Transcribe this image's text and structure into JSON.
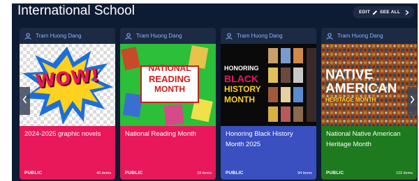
{
  "header": {
    "title": "International School",
    "edit_label": "EDIT",
    "see_all_label": "SEE ALL"
  },
  "icons": {
    "user": "user-icon",
    "edit": "pencil-icon",
    "see_all": "chevron-right-icon",
    "prev": "chevron-left-icon",
    "next": "chevron-right-icon"
  },
  "colors": {
    "panel": "#0d1b33",
    "card_header": "#1c2a44",
    "owner_text": "#8ab4ff",
    "pink": "#e8185a",
    "blue": "#3a4fc0",
    "green": "#1e7a1e"
  },
  "cards": [
    {
      "owner": "Tram Huong Dang",
      "title": "2024-2025 graphic novels",
      "visibility": "PUBLIC",
      "count": "40 items",
      "color": "#e8185a",
      "thumb_text": "WOW!"
    },
    {
      "owner": "Tram Huong Dang",
      "title": "National Reading Month",
      "visibility": "PUBLIC",
      "count": "18 items",
      "color": "#e8185a",
      "thumb_lines": [
        "NATIONAL",
        "READING",
        "MONTH"
      ]
    },
    {
      "owner": "Tram Huong Dang",
      "title": "Honoring Black History Month 2025",
      "visibility": "PUBLIC",
      "count": "94 items",
      "color": "#3a4fc0",
      "thumb_lines": [
        "HONORING",
        "BLACK",
        "HISTORY",
        "MONTH"
      ]
    },
    {
      "owner": "Tram Huong Dang",
      "title": "National Native American Heritage Month",
      "visibility": "PUBLIC",
      "count": "102 items",
      "color": "#1e7a1e",
      "thumb_lines": [
        "NATIVE",
        "AMERICAN",
        "HERITAGE MONTH"
      ]
    }
  ]
}
